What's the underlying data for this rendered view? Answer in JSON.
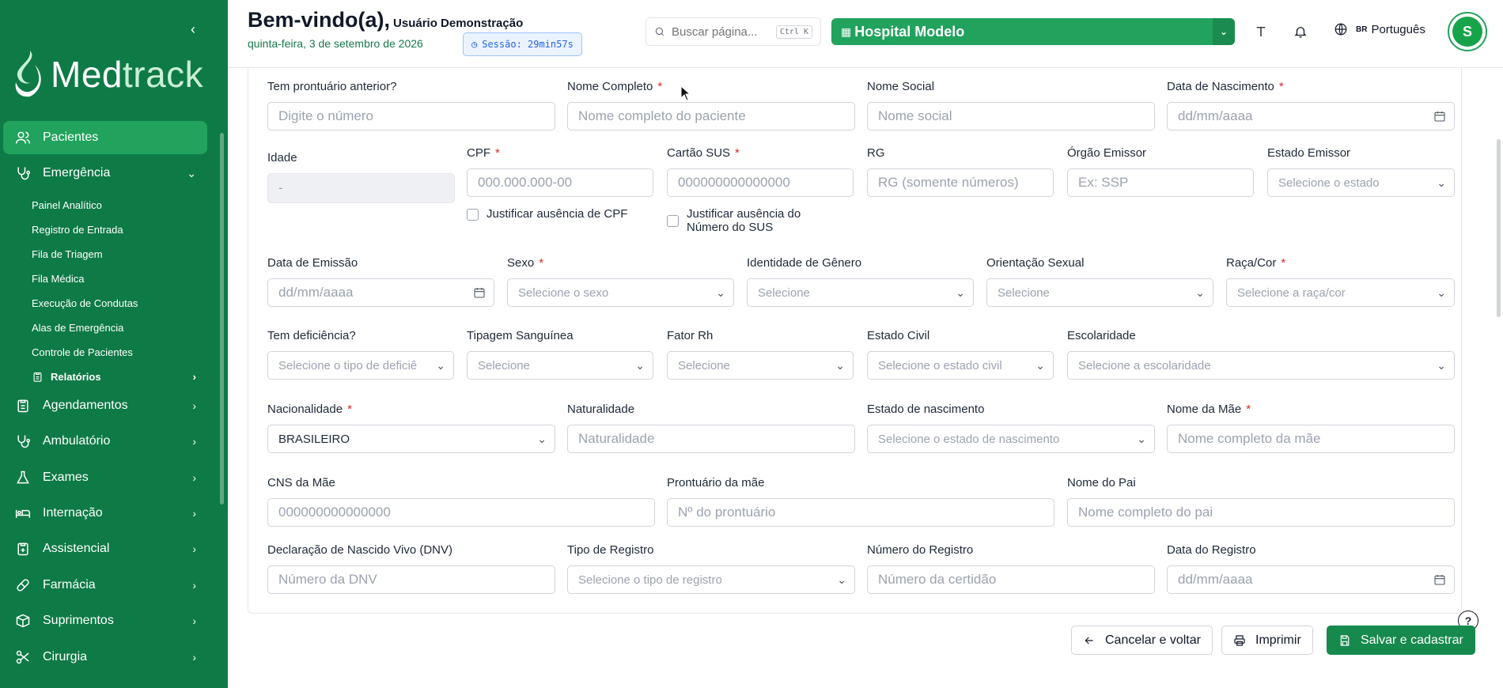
{
  "sidebar": {
    "logo": {
      "part1": "Med",
      "part2": "track"
    },
    "items": [
      {
        "label": "Pacientes",
        "icon": "users-icon"
      },
      {
        "label": "Emergência",
        "icon": "stethoscope-icon"
      },
      {
        "label": "Agendamentos",
        "icon": "clipboard-icon"
      },
      {
        "label": "Ambulatório",
        "icon": "stethoscope-icon"
      },
      {
        "label": "Exames",
        "icon": "flask-icon"
      },
      {
        "label": "Internação",
        "icon": "bed-icon"
      },
      {
        "label": "Assistencial",
        "icon": "clipboard-plus-icon"
      },
      {
        "label": "Farmácia",
        "icon": "pill-icon"
      },
      {
        "label": "Suprimentos",
        "icon": "package-icon"
      },
      {
        "label": "Cirurgia",
        "icon": "scissors-icon"
      }
    ],
    "emergency_sub": [
      "Painel Analítico",
      "Registro de Entrada",
      "Fila de Triagem",
      "Fila Médica",
      "Execução de Condutas",
      "Alas de Emergência",
      "Controle de Pacientes"
    ],
    "reports_label": "Relatórios"
  },
  "header": {
    "welcome": "Bem-vindo(a),",
    "user": "Usuário Demonstração",
    "date": "quinta-feira, 3 de setembro de 2026",
    "session": "Sessão: 29min57s",
    "search_placeholder": "Buscar página...",
    "search_shortcut": "Ctrl K",
    "hospital": "Hospital Modelo",
    "language_flag": "BR",
    "language": "Português",
    "avatar_initial": "S"
  },
  "form": {
    "prontuario_anterior": {
      "label": "Tem prontuário anterior?",
      "placeholder": "Digite o número"
    },
    "nome_completo": {
      "label": "Nome Completo",
      "placeholder": "Nome completo do paciente"
    },
    "nome_social": {
      "label": "Nome Social",
      "placeholder": "Nome social"
    },
    "data_nascimento": {
      "label": "Data de Nascimento",
      "placeholder": "dd/mm/aaaa"
    },
    "idade": {
      "label": "Idade",
      "value": "-"
    },
    "cpf": {
      "label": "CPF",
      "placeholder": "000.000.000-00"
    },
    "cartao_sus": {
      "label": "Cartão SUS",
      "placeholder": "000000000000000"
    },
    "rg": {
      "label": "RG",
      "placeholder": "RG (somente números)"
    },
    "orgao_emissor": {
      "label": "Órgão Emissor",
      "placeholder": "Ex: SSP"
    },
    "estado_emissor": {
      "label": "Estado Emissor",
      "placeholder": "Selecione o estado"
    },
    "justificar_cpf": "Justificar ausência de CPF",
    "justificar_sus_1": "Justificar ausência do",
    "justificar_sus_2": "Número do SUS",
    "data_emissao": {
      "label": "Data de Emissão",
      "placeholder": "dd/mm/aaaa"
    },
    "sexo": {
      "label": "Sexo",
      "placeholder": "Selecione o sexo"
    },
    "identidade_genero": {
      "label": "Identidade de Gênero",
      "placeholder": "Selecione"
    },
    "orientacao_sexual": {
      "label": "Orientação Sexual",
      "placeholder": "Selecione"
    },
    "raca_cor": {
      "label": "Raça/Cor",
      "placeholder": "Selecione a raça/cor"
    },
    "deficiencia": {
      "label": "Tem deficiência?",
      "placeholder": "Selecione o tipo de deficiê"
    },
    "tipagem": {
      "label": "Tipagem Sanguínea",
      "placeholder": "Selecione"
    },
    "fator_rh": {
      "label": "Fator Rh",
      "placeholder": "Selecione"
    },
    "estado_civil": {
      "label": "Estado Civil",
      "placeholder": "Selecione o estado civil"
    },
    "escolaridade": {
      "label": "Escolaridade",
      "placeholder": "Selecione a escolaridade"
    },
    "nacionalidade": {
      "label": "Nacionalidade",
      "value": "BRASILEIRO"
    },
    "naturalidade": {
      "label": "Naturalidade",
      "placeholder": "Naturalidade"
    },
    "estado_nascimento": {
      "label": "Estado de nascimento",
      "placeholder": "Selecione o estado de nascimento"
    },
    "nome_mae": {
      "label": "Nome da Mãe",
      "placeholder": "Nome completo da mãe"
    },
    "cns_mae": {
      "label": "CNS da Mãe",
      "placeholder": "000000000000000"
    },
    "prontuario_mae": {
      "label": "Prontuário da mãe",
      "placeholder": "Nº do prontuário"
    },
    "nome_pai": {
      "label": "Nome do Pai",
      "placeholder": "Nome completo do pai"
    },
    "dnv": {
      "label": "Declaração de Nascido Vivo (DNV)",
      "placeholder": "Número da DNV"
    },
    "tipo_registro": {
      "label": "Tipo de Registro",
      "placeholder": "Selecione o tipo de registro"
    },
    "numero_registro": {
      "label": "Número do Registro",
      "placeholder": "Número da certidão"
    },
    "data_registro": {
      "label": "Data do Registro",
      "placeholder": "dd/mm/aaaa"
    }
  },
  "actions": {
    "cancel": "Cancelar e voltar",
    "print": "Imprimir",
    "save": "Salvar e cadastrar",
    "help": "?"
  },
  "colors": {
    "brand": "#0e7a45",
    "accent": "#22a35d",
    "required": "#dc2626"
  }
}
